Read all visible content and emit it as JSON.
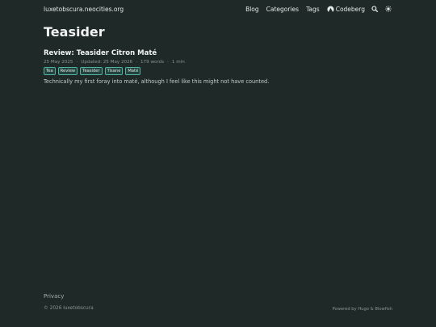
{
  "header": {
    "site_title": "luxetobscura.neocities.org",
    "nav": {
      "blog": "Blog",
      "categories": "Categories",
      "tags": "Tags",
      "codeberg": "Codeberg"
    },
    "icons": {
      "codeberg": "codeberg-icon",
      "search": "search-icon",
      "theme": "sun-icon"
    }
  },
  "main": {
    "page_title": "Teasider",
    "article": {
      "title": "Review: Teasider Citron Maté",
      "published": "25 May 2025",
      "updated": "Updated: 25 May 2026",
      "words": "179 words",
      "read_time": "1 min",
      "tags": [
        "Tea",
        "Review",
        "Teasider",
        "Tisane",
        "Maté"
      ],
      "summary": "Technically my first foray into maté, although I feel like this might not have counted."
    }
  },
  "footer": {
    "privacy": "Privacy",
    "copyright": "© 2026 luxetobscura",
    "powered": "Powered by Hugo & Blowfish"
  },
  "colors": {
    "background": "#1f2a28",
    "tag_border": "#4fb3a2",
    "tag_bg": "#25433e"
  }
}
